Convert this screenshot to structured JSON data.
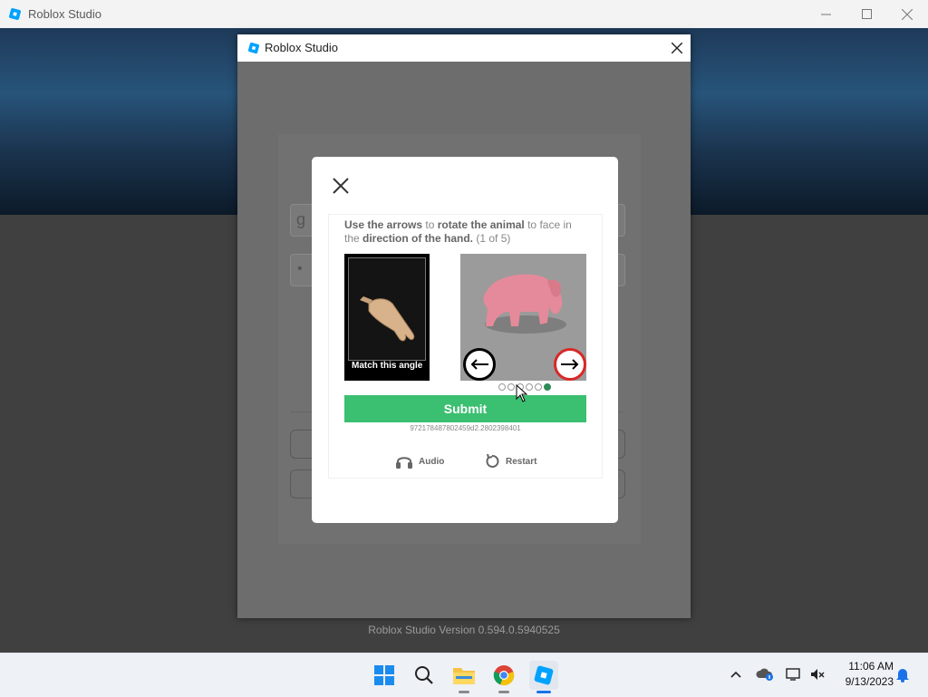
{
  "outer_window": {
    "title": "Roblox Studio"
  },
  "studio_dialog": {
    "title": "Roblox Studio",
    "background_field1_text": "g",
    "background_field2_text": "•"
  },
  "captcha": {
    "instruction": {
      "part1": "Use the arrows",
      "part2": " to ",
      "part3": "rotate the animal",
      "part4": " to face in the ",
      "part5": "direction of the hand.",
      "part6": " (1 of 5)"
    },
    "hand_caption": "Match this angle",
    "dots_total": 6,
    "active_dot": 6,
    "submit_label": "Submit",
    "session_id": "972178487802459d2.2802398401",
    "audio_label": "Audio",
    "restart_label": "Restart"
  },
  "version_text": "Roblox Studio Version 0.594.0.5940525",
  "taskbar": {
    "apps": [
      "start-icon",
      "search-icon",
      "file-explorer-icon",
      "chrome-icon",
      "roblox-studio-icon"
    ],
    "time": "11:06 AM",
    "date": "9/13/2023"
  },
  "colors": {
    "submit": "#3bbf71",
    "right_arrow_ring": "#d92828",
    "active_dot": "#2e8b57"
  }
}
